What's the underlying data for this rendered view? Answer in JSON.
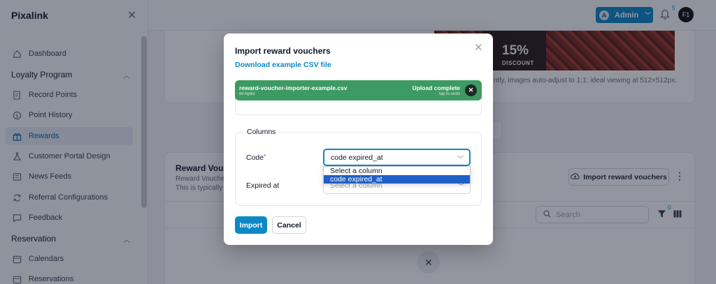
{
  "app": {
    "brand": "Pixalink"
  },
  "sidebar": {
    "items": [
      {
        "label": "Dashboard",
        "icon": "home-icon"
      },
      {
        "label": "Record Points",
        "icon": "document-icon"
      },
      {
        "label": "Point History",
        "icon": "dollar-icon"
      },
      {
        "label": "Rewards",
        "icon": "gift-icon",
        "active": true
      },
      {
        "label": "Customer Portal Design",
        "icon": "flask-icon"
      },
      {
        "label": "News Feeds",
        "icon": "newspaper-icon"
      },
      {
        "label": "Referral Configurations",
        "icon": "refresh-icon"
      },
      {
        "label": "Feedback",
        "icon": "chat-icon"
      },
      {
        "label": "Calendars",
        "icon": "calendar-icon"
      },
      {
        "label": "Reservations",
        "icon": "calendar-icon"
      }
    ],
    "sections": [
      {
        "label": "Loyalty Program"
      },
      {
        "label": "Reservation"
      }
    ]
  },
  "topbar": {
    "admin_label": "Admin",
    "admin_initial": "A",
    "notification_count": "5",
    "user_initials": "F1"
  },
  "background": {
    "promo_text": "15%",
    "promo_sub": "DISCOUNT",
    "image_note": "ntly, images auto-adjust to 1:1; ideal viewing at 512×512px.",
    "card_title": "Reward Vouche",
    "card_desc_1": "Reward Vouche",
    "card_desc_2": "This is typically",
    "import_button": "Import reward vouchers",
    "search_placeholder": "Search",
    "filter_count": "0"
  },
  "modal": {
    "title": "Import reward vouchers",
    "download_link": "Download example CSV file",
    "file": {
      "name": "reward-voucher-importer-example.csv",
      "size": "69 bytes",
      "status": "Upload complete",
      "undo_hint": "tap to undo"
    },
    "columns_legend": "Columns",
    "code_label": "Code",
    "required_mark": "*",
    "code_value": "code expired_at",
    "expired_label": "Expired at",
    "expired_placeholder": "Select a column",
    "dropdown_options": [
      "Select a column",
      "code expired_at"
    ],
    "import_button": "Import",
    "cancel_button": "Cancel"
  },
  "colors": {
    "accent": "#0c88c7",
    "success": "#3d9a62",
    "selected_option": "#1f5fc6"
  }
}
